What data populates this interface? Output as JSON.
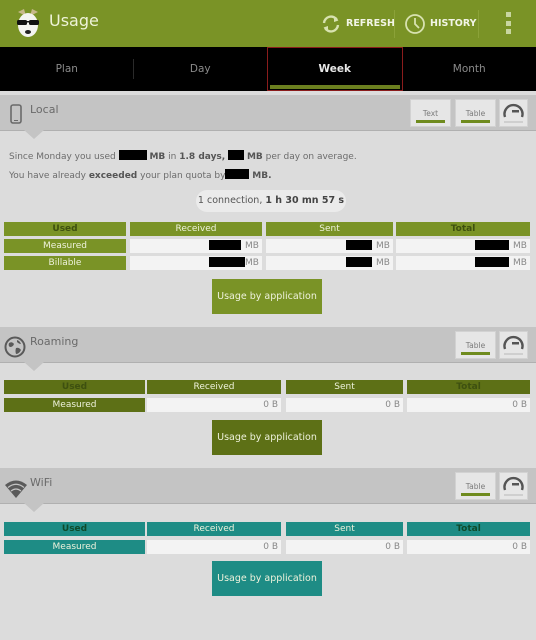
{
  "app": {
    "title": "Usage",
    "logo_icon": "dog-with-sunglasses-logo"
  },
  "actionbar": {
    "refresh_label": "REFRESH",
    "history_label": "HISTORY",
    "colors": {
      "bar": "#7a9326"
    }
  },
  "tabs": [
    {
      "label": "Plan",
      "selected": false
    },
    {
      "label": "Day",
      "selected": false
    },
    {
      "label": "Week",
      "selected": true
    },
    {
      "label": "Month",
      "selected": false
    }
  ],
  "sections": {
    "local": {
      "title": "Local",
      "icon": "phone-icon",
      "view_buttons": [
        "Text",
        "Table"
      ],
      "summary": {
        "line1_a": "Since Monday you used",
        "line1_b": "MB",
        "line1_c": "in",
        "days": "1.8 days",
        "line1_d": "MB",
        "line1_e": "per day on average.",
        "line2_a": "You have already",
        "line2_b": "exceeded",
        "line2_c": "your plan quota by",
        "line2_d": "MB."
      },
      "connection_count": "1 connection,",
      "connection_time": "1 h 30 mn 57 s",
      "table": {
        "headers": [
          "Used",
          "Received",
          "Sent",
          "Total"
        ],
        "rows": [
          {
            "label": "Measured",
            "received_unit": "MB",
            "sent_unit": "MB",
            "total_unit": "MB"
          },
          {
            "label": "Billable",
            "received_unit": "MB",
            "sent_unit": "MB",
            "total_unit": "MB"
          }
        ]
      },
      "button": "Usage by application",
      "color": "#7a9326"
    },
    "roaming": {
      "title": "Roaming",
      "icon": "globe-icon",
      "view_buttons": [
        "Table"
      ],
      "table": {
        "headers": [
          "Used",
          "Received",
          "Sent",
          "Total"
        ],
        "rows": [
          {
            "label": "Measured",
            "received": "0 B",
            "sent": "0 B",
            "total": "0 B"
          }
        ]
      },
      "button": "Usage by application",
      "color": "#5d7016"
    },
    "wifi": {
      "title": "WiFi",
      "icon": "wifi-icon",
      "view_buttons": [
        "Table"
      ],
      "table": {
        "headers": [
          "Used",
          "Received",
          "Sent",
          "Total"
        ],
        "rows": [
          {
            "label": "Measured",
            "received": "0 B",
            "sent": "0 B",
            "total": "0 B"
          }
        ]
      },
      "button": "Usage by application",
      "color": "#1e8c85"
    }
  }
}
